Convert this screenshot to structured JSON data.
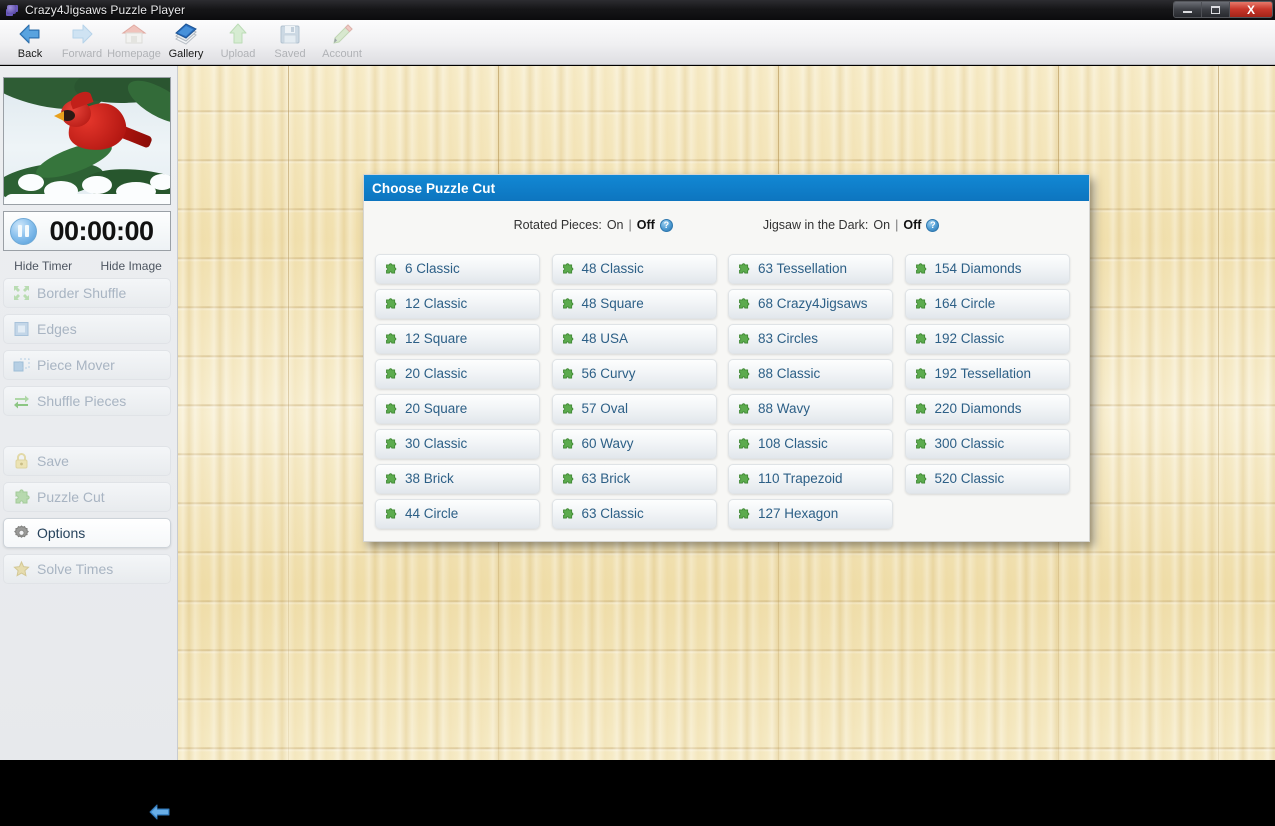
{
  "window": {
    "title": "Crazy4Jigsaws Puzzle Player",
    "app_icon": "puzzle-piece-icon",
    "controls": {
      "minimize": "minimize-icon",
      "maximize": "restore-icon",
      "close": "X"
    }
  },
  "toolbar": {
    "items": [
      {
        "label": "Back",
        "icon": "back-arrow-icon",
        "enabled": true
      },
      {
        "label": "Forward",
        "icon": "forward-arrow-icon",
        "enabled": false
      },
      {
        "label": "Homepage",
        "icon": "home-icon",
        "enabled": false
      },
      {
        "label": "Gallery",
        "icon": "book-icon",
        "enabled": true
      },
      {
        "label": "Upload",
        "icon": "up-arrow-icon",
        "enabled": false
      },
      {
        "label": "Saved",
        "icon": "floppy-disk-icon",
        "enabled": false
      },
      {
        "label": "Account",
        "icon": "pencil-icon",
        "enabled": false
      }
    ]
  },
  "sidebar": {
    "thumbnail_alt": "cardinal-bird-in-snowy-pine-photo",
    "timer": {
      "value": "00:00:00",
      "pause_icon": "pause-icon"
    },
    "hide_links": [
      {
        "label": "Hide Timer"
      },
      {
        "label": "Hide Image"
      }
    ],
    "items": [
      {
        "label": "Border Shuffle",
        "icon": "border-shuffle-icon",
        "active": false
      },
      {
        "label": "Edges",
        "icon": "edges-icon",
        "active": false
      },
      {
        "label": "Piece Mover",
        "icon": "piece-mover-icon",
        "active": false
      },
      {
        "label": "Shuffle Pieces",
        "icon": "shuffle-icon",
        "active": false
      },
      {
        "label": "Save",
        "icon": "lock-icon",
        "active": false
      },
      {
        "label": "Puzzle Cut",
        "icon": "puzzle-piece-icon",
        "active": false
      },
      {
        "label": "Options",
        "icon": "gear-icon",
        "active": true
      },
      {
        "label": "Solve Times",
        "icon": "star-icon",
        "active": false
      }
    ],
    "collapse_icon": "left-arrow-icon"
  },
  "dialog": {
    "title": "Choose Puzzle Cut",
    "toggles": [
      {
        "label": "Rotated Pieces:",
        "on_label": "On",
        "separator": "|",
        "off_label": "Off",
        "selected": "Off",
        "help_icon": "question-mark-icon",
        "help_glyph": "?"
      },
      {
        "label": "Jigsaw in the Dark:",
        "on_label": "On",
        "separator": "|",
        "off_label": "Off",
        "selected": "Off",
        "help_icon": "question-mark-icon",
        "help_glyph": "?"
      }
    ],
    "cut_columns": [
      {
        "buttons": [
          {
            "label": "6 Classic"
          },
          {
            "label": "12 Classic"
          },
          {
            "label": "12 Square"
          },
          {
            "label": "20 Classic"
          },
          {
            "label": "20 Square"
          },
          {
            "label": "30 Classic"
          },
          {
            "label": "38 Brick"
          },
          {
            "label": "44 Circle"
          }
        ]
      },
      {
        "buttons": [
          {
            "label": "48 Classic"
          },
          {
            "label": "48 Square"
          },
          {
            "label": "48 USA"
          },
          {
            "label": "56 Curvy"
          },
          {
            "label": "57 Oval"
          },
          {
            "label": "60 Wavy"
          },
          {
            "label": "63 Brick"
          },
          {
            "label": "63 Classic"
          }
        ]
      },
      {
        "buttons": [
          {
            "label": "63 Tessellation"
          },
          {
            "label": "68 Crazy4Jigsaws"
          },
          {
            "label": "83 Circles"
          },
          {
            "label": "88 Classic"
          },
          {
            "label": "88 Wavy"
          },
          {
            "label": "108 Classic"
          },
          {
            "label": "110 Trapezoid"
          },
          {
            "label": "127 Hexagon"
          }
        ]
      },
      {
        "buttons": [
          {
            "label": "154 Diamonds"
          },
          {
            "label": "164 Circle"
          },
          {
            "label": "192 Classic"
          },
          {
            "label": "192 Tessellation"
          },
          {
            "label": "220 Diamonds"
          },
          {
            "label": "300 Classic"
          },
          {
            "label": "520 Classic"
          }
        ]
      }
    ]
  },
  "colors": {
    "dialog_title_blue": "#0d7ac4",
    "cut_button_text": "#2c5f86",
    "puzzle_icon_green": "#5cab4e",
    "wood_background": "#f1e0ae",
    "sidebar_background": "#eaecef",
    "active_item_text": "#27435c",
    "disabled_text": "#a8b4c2",
    "close_button_red": "#c8362a"
  }
}
